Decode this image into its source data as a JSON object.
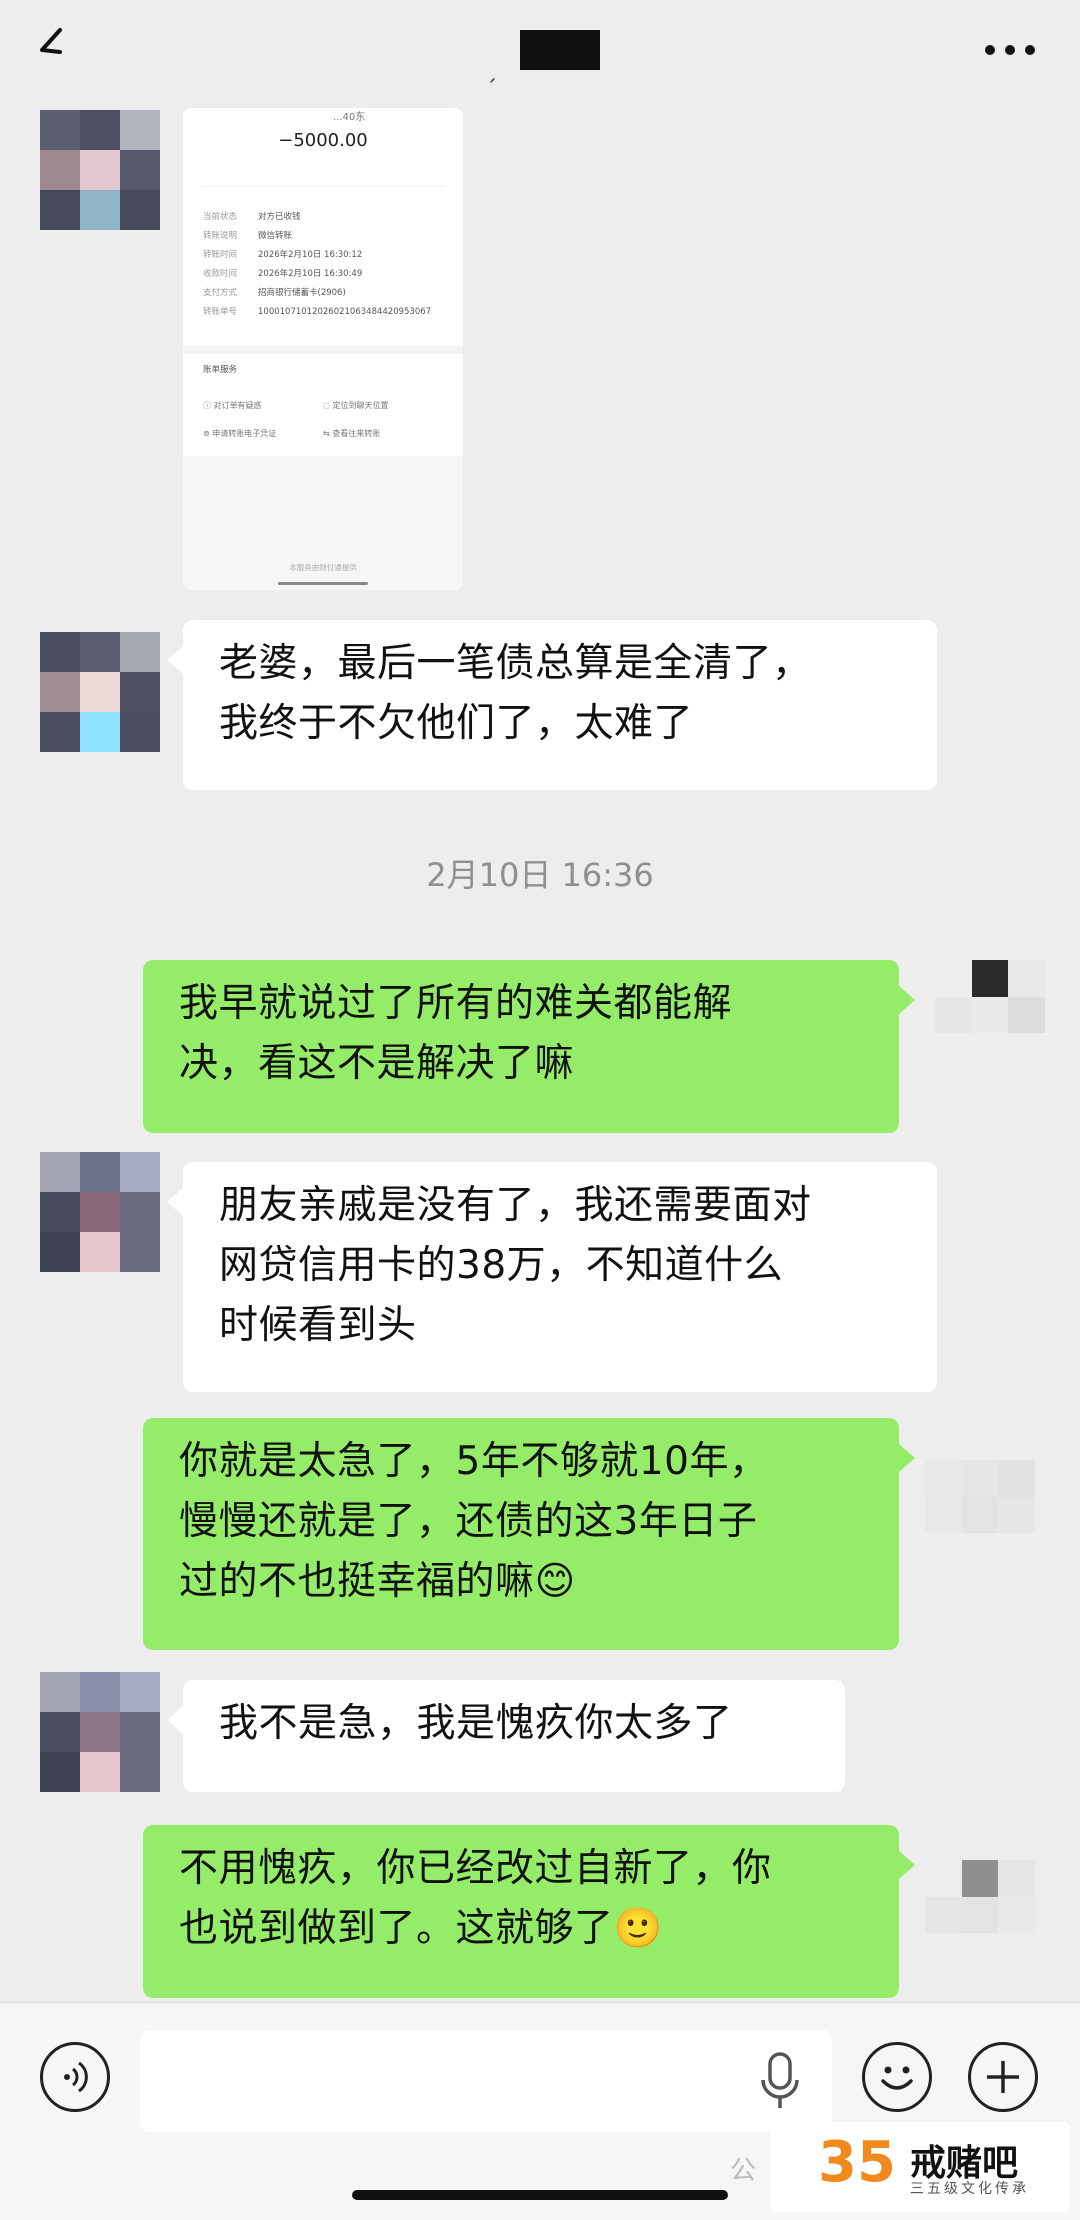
{
  "transfer_card": {
    "top_label": "...40东",
    "amount": "−5000.00",
    "rows": [
      {
        "key": "当前状态",
        "value": "对方已收钱"
      },
      {
        "key": "转账说明",
        "value": "微信转账"
      },
      {
        "key": "转账时间",
        "value": "2026年2月10日 16:30:12"
      },
      {
        "key": "收款时间",
        "value": "2026年2月10日 16:30:49"
      },
      {
        "key": "支付方式",
        "value": "招商银行储蓄卡(2906)"
      },
      {
        "key": "转账单号",
        "value": "10001071012026021063484420953067"
      }
    ],
    "services_title": "账单服务",
    "services": [
      "对订单有疑惑",
      "定位到聊天位置",
      "申请转账电子凭证",
      "查看往来转账"
    ],
    "footer_note": "本服务由财付通提供"
  },
  "messages": [
    {
      "side": "left",
      "text": "老婆，最后一笔债总算是全清了，\n我终于不欠他们了，太难了"
    },
    {
      "side": "right",
      "text": "我早就说过了所有的难关都能解\n决，看这不是解决了嘛"
    },
    {
      "side": "left",
      "text": "朋友亲戚是没有了，我还需要面对\n网贷信用卡的38万，不知道什么\n时候看到头"
    },
    {
      "side": "right",
      "text": "你就是太急了，5年不够就10年，\n慢慢还就是了，还债的这3年日子\n过的不也挺幸福的嘛😊"
    },
    {
      "side": "left",
      "text": "我不是急，我是愧疚你太多了"
    },
    {
      "side": "right",
      "text": "不用愧疚，你已经改过自新了，你\n也说到做到了。这就够了🙂"
    }
  ],
  "timestamp": "2月10日 16:36",
  "watermark": {
    "number": "35",
    "name": "戒赌吧",
    "subtitle": "三五级文化传承",
    "wechat_label": "公"
  },
  "icons": {
    "back": "back-arrow-icon",
    "more": "more-dots-icon",
    "voice": "voice-icon",
    "mic": "microphone-icon",
    "emoji": "emoji-icon",
    "plus": "plus-icon"
  },
  "colors": {
    "bg": "#ededed",
    "bubble_green": "#95ec69",
    "bubble_white": "#ffffff"
  }
}
